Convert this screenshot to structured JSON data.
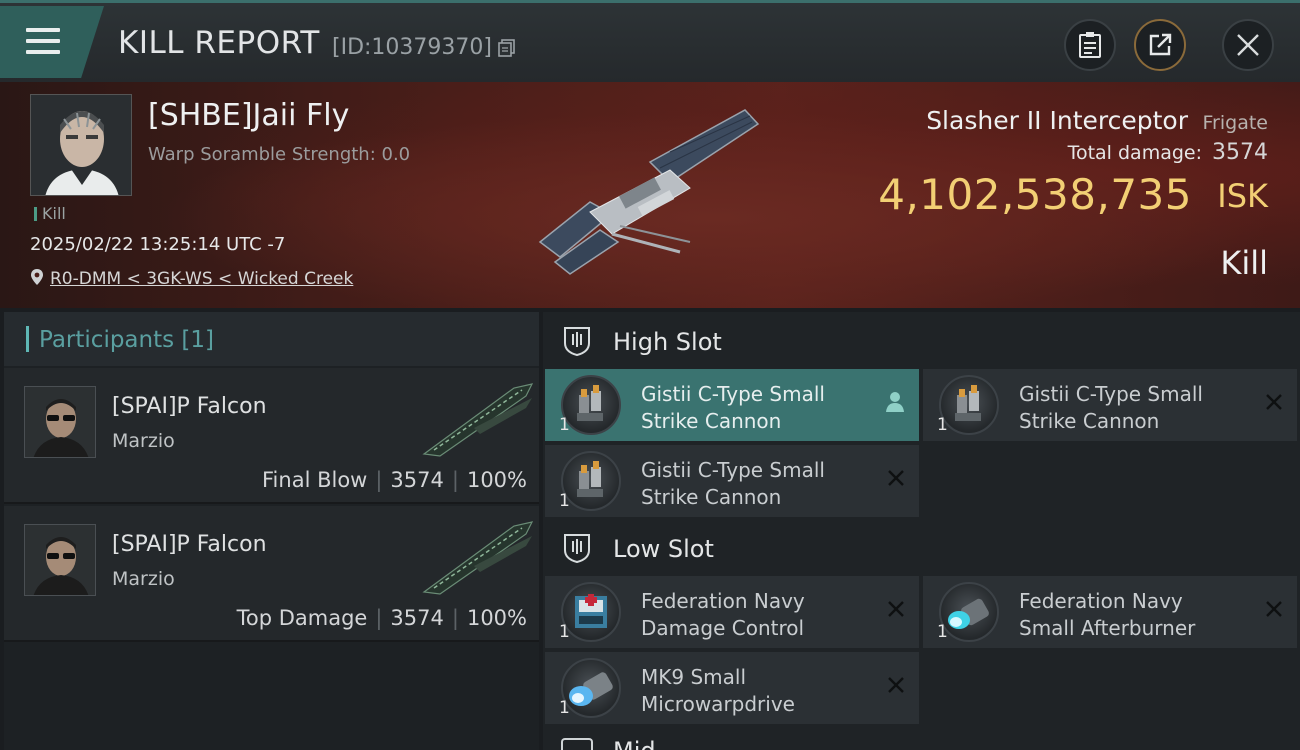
{
  "header": {
    "title": "KILL REPORT",
    "report_id": "[ID:10379370]",
    "icons": [
      "menu-icon",
      "copy-icon",
      "clipboard-icon",
      "share-icon",
      "close-icon"
    ]
  },
  "victim": {
    "name": "[SHBE]Jaii Fly",
    "scramble": "Warp Soramble Strength: 0.0",
    "tag": "Kill",
    "datetime": "2025/02/22 13:25:14 UTC -7",
    "location": "R0-DMM < 3GK-WS < Wicked Creek",
    "ship_name": "Slasher II Interceptor",
    "ship_class": "Frigate",
    "total_damage_label": "Total damage:",
    "total_damage": "3574",
    "isk_value": "4,102,538,735",
    "isk_unit": "ISK",
    "result": "Kill"
  },
  "participants": {
    "title": "Participants",
    "count": "[1]",
    "rows": [
      {
        "name": "[SPAI]P Falcon",
        "corp": "Marzio",
        "role": "Final Blow",
        "damage": "3574",
        "percent": "100%"
      },
      {
        "name": "[SPAI]P Falcon",
        "corp": "Marzio",
        "role": "Top Damage",
        "damage": "3574",
        "percent": "100%"
      }
    ]
  },
  "slots": {
    "high": {
      "label": "High Slot",
      "modules": [
        {
          "qty": "1",
          "line1": "Gistii C-Type Small",
          "line2": "Strike Cannon"
        },
        {
          "qty": "1",
          "line1": "Gistii C-Type Small",
          "line2": "Strike Cannon"
        },
        {
          "qty": "1",
          "line1": "Gistii C-Type Small",
          "line2": "Strike Cannon"
        }
      ]
    },
    "low": {
      "label": "Low Slot",
      "modules": [
        {
          "qty": "1",
          "line1": "Federation Navy",
          "line2": "Damage Control"
        },
        {
          "qty": "1",
          "line1": "Federation Navy",
          "line2": "Small Afterburner"
        },
        {
          "qty": "1",
          "line1": "MK9 Small",
          "line2": "Microwarpdrive"
        }
      ]
    },
    "mid_peek_label": "Mid Slot"
  },
  "colors": {
    "accent_teal": "#3a7370",
    "isk_gold": "#f2cf74",
    "hero_red": "#5a221c"
  }
}
